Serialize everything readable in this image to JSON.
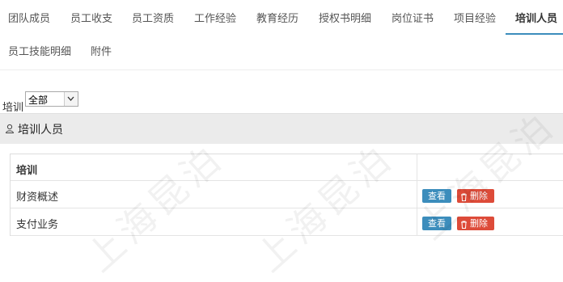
{
  "tabs": {
    "row1": [
      "团队成员",
      "员工收支",
      "员工资质",
      "工作经验",
      "教育经历",
      "授权书明细",
      "岗位证书",
      "项目经验",
      "培训人员"
    ],
    "row2": [
      "员工技能明细",
      "附件"
    ],
    "active": "培训人员"
  },
  "filter": {
    "label": "培训",
    "selected": "全部"
  },
  "panel": {
    "title": "培训人员",
    "icon": "user-icon"
  },
  "table": {
    "header": "培训",
    "rows": [
      {
        "name": "财资概述"
      },
      {
        "name": "支付业务"
      }
    ],
    "view_label": "查看",
    "delete_label": "删除"
  },
  "watermark": "上海昆泊",
  "colors": {
    "accent": "#3c8dbc",
    "danger": "#dd4b39",
    "panel_bg": "#ebebeb"
  }
}
